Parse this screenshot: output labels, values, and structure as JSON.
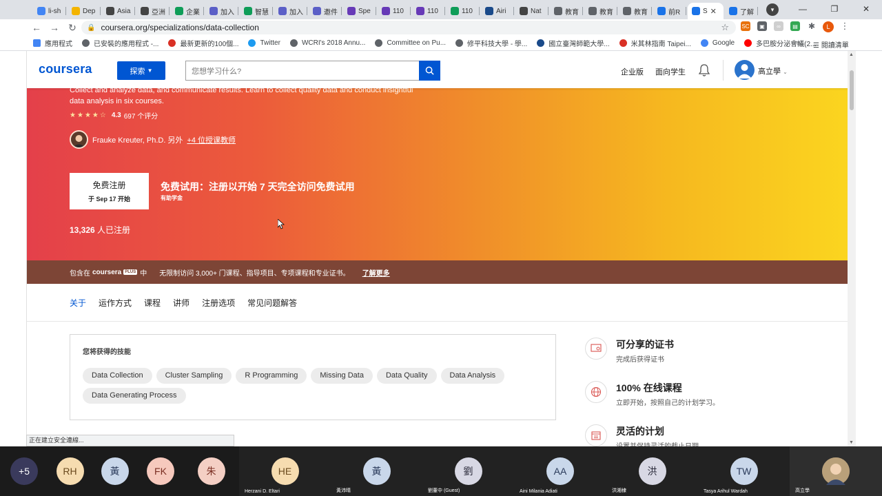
{
  "tabs": [
    {
      "label": "li-sh",
      "color": "#4285f4"
    },
    {
      "label": "Dep",
      "color": "#f4b400"
    },
    {
      "label": "Asia",
      "color": "#444444"
    },
    {
      "label": "亞洲",
      "color": "#444444"
    },
    {
      "label": "企業",
      "color": "#0f9d58"
    },
    {
      "label": "加入",
      "color": "#5b5fc7"
    },
    {
      "label": "智慧",
      "color": "#0f9d58"
    },
    {
      "label": "加入",
      "color": "#5b5fc7"
    },
    {
      "label": "邀件",
      "color": "#5b5fc7"
    },
    {
      "label": "Spe",
      "color": "#673ab7"
    },
    {
      "label": "110",
      "color": "#673ab7"
    },
    {
      "label": "110",
      "color": "#673ab7"
    },
    {
      "label": "110",
      "color": "#0f9d58"
    },
    {
      "label": "Airi",
      "color": "#1a4a8a"
    },
    {
      "label": "Nat",
      "color": "#444444"
    },
    {
      "label": "教育",
      "color": "#5f6368"
    },
    {
      "label": "教育",
      "color": "#5f6368"
    },
    {
      "label": "教育",
      "color": "#5f6368"
    },
    {
      "label": "前R",
      "color": "#1a73e8"
    },
    {
      "label": "S",
      "color": "#1a73e8",
      "active": true
    },
    {
      "label": "了解",
      "color": "#1a73e8"
    }
  ],
  "url": "coursera.org/specializations/data-collection",
  "bookmarks": [
    "應用程式",
    "已安裝的應用程式 -...",
    "最新更新的100個...",
    "Twitter",
    "WCRI's 2018 Annu...",
    "Committee on Pu...",
    "修平科技大學 - 學...",
    "國立臺灣師範大學...",
    "米其林指南 Taipei...",
    "Google",
    "多巴胺分泌會議(2..."
  ],
  "reading_list": "閱讀清單",
  "profile_initial": "L",
  "header": {
    "logo": "coursera",
    "explore": "探索",
    "search_placeholder": "您想学习什么?",
    "enterprise": "企业版",
    "students": "面向学生",
    "username": "高立學"
  },
  "hero": {
    "description": "Collect and analyze data, and communicate results. Learn to collect quality data and conduct insightful data analysis in six courses.",
    "rating": "4.3",
    "reviews": "697 个评分",
    "instructor": "Frauke Kreuter, Ph.D. 另外",
    "more_instructors": "+4 位授课教师",
    "enroll_label": "免费注册",
    "enroll_date": "于 Sep 17 开始",
    "trial": "免费试用：注册以开始 7 天完全访问免费试用",
    "aid": "有助学金",
    "enrolled_count": "13,326",
    "enrolled_suffix": "人已注册"
  },
  "plus": {
    "prefix": "包含在",
    "brand": "coursera",
    "badge": "PLUS",
    "suffix": "中",
    "text": "无限制访问 3,000+ 门课程、指导项目、专项课程和专业证书。",
    "link": "了解更多"
  },
  "page_tabs": [
    "关于",
    "运作方式",
    "课程",
    "讲师",
    "注册选项",
    "常见问题解答"
  ],
  "skills": {
    "title": "您将获得的技能",
    "items": [
      "Data Collection",
      "Cluster Sampling",
      "R Programming",
      "Missing Data",
      "Data Quality",
      "Data Analysis",
      "Data Generating Process"
    ]
  },
  "features": [
    {
      "title": "可分享的证书",
      "sub": "完成后获得证书",
      "icon": "certificate-icon"
    },
    {
      "title": "100% 在线课程",
      "sub": "立即开始，按照自己的计划学习。",
      "icon": "globe-icon"
    },
    {
      "title": "灵活的计划",
      "sub": "设置并保持灵活的截止日期。",
      "icon": "calendar-icon"
    }
  ],
  "status": "正在建立安全連線...",
  "participants": [
    {
      "initials": "+5",
      "name": "",
      "bg": "#3a3a5c",
      "fg": "#ffffff"
    },
    {
      "initials": "RH",
      "name": "",
      "bg": "#f6dcb0",
      "fg": "#6a4a1e"
    },
    {
      "initials": "黃",
      "name": "",
      "bg": "#c9d7ea",
      "fg": "#2a3a5a"
    },
    {
      "initials": "FK",
      "name": "",
      "bg": "#f6c9bd",
      "fg": "#7a2e22"
    },
    {
      "initials": "朱",
      "name": "",
      "bg": "#f4cfc4",
      "fg": "#7a2e22"
    },
    {
      "initials": "HE",
      "name": "Herzani D. Eltari",
      "bg": "#f6dcb0",
      "fg": "#6a4a1e"
    },
    {
      "initials": "黃",
      "name": "黃沛晴",
      "bg": "#c9d7ea",
      "fg": "#2a3a5a"
    },
    {
      "initials": "劉",
      "name": "劉董中 (Guest)",
      "bg": "#d8d8e4",
      "fg": "#2a2a3a"
    },
    {
      "initials": "AA",
      "name": "Aini Milania Adiati",
      "bg": "#c9d7ea",
      "fg": "#2a3a5a"
    },
    {
      "initials": "洪",
      "name": "洪湘棣",
      "bg": "#d8d8e4",
      "fg": "#2a2a3a"
    },
    {
      "initials": "TW",
      "name": "Tasya Arihul Wardah",
      "bg": "#c9d7ea",
      "fg": "#2a3a5a"
    },
    {
      "initials": "",
      "name": "高立學",
      "bg": "#b9a07a",
      "fg": "#ffffff",
      "photo": true
    }
  ]
}
